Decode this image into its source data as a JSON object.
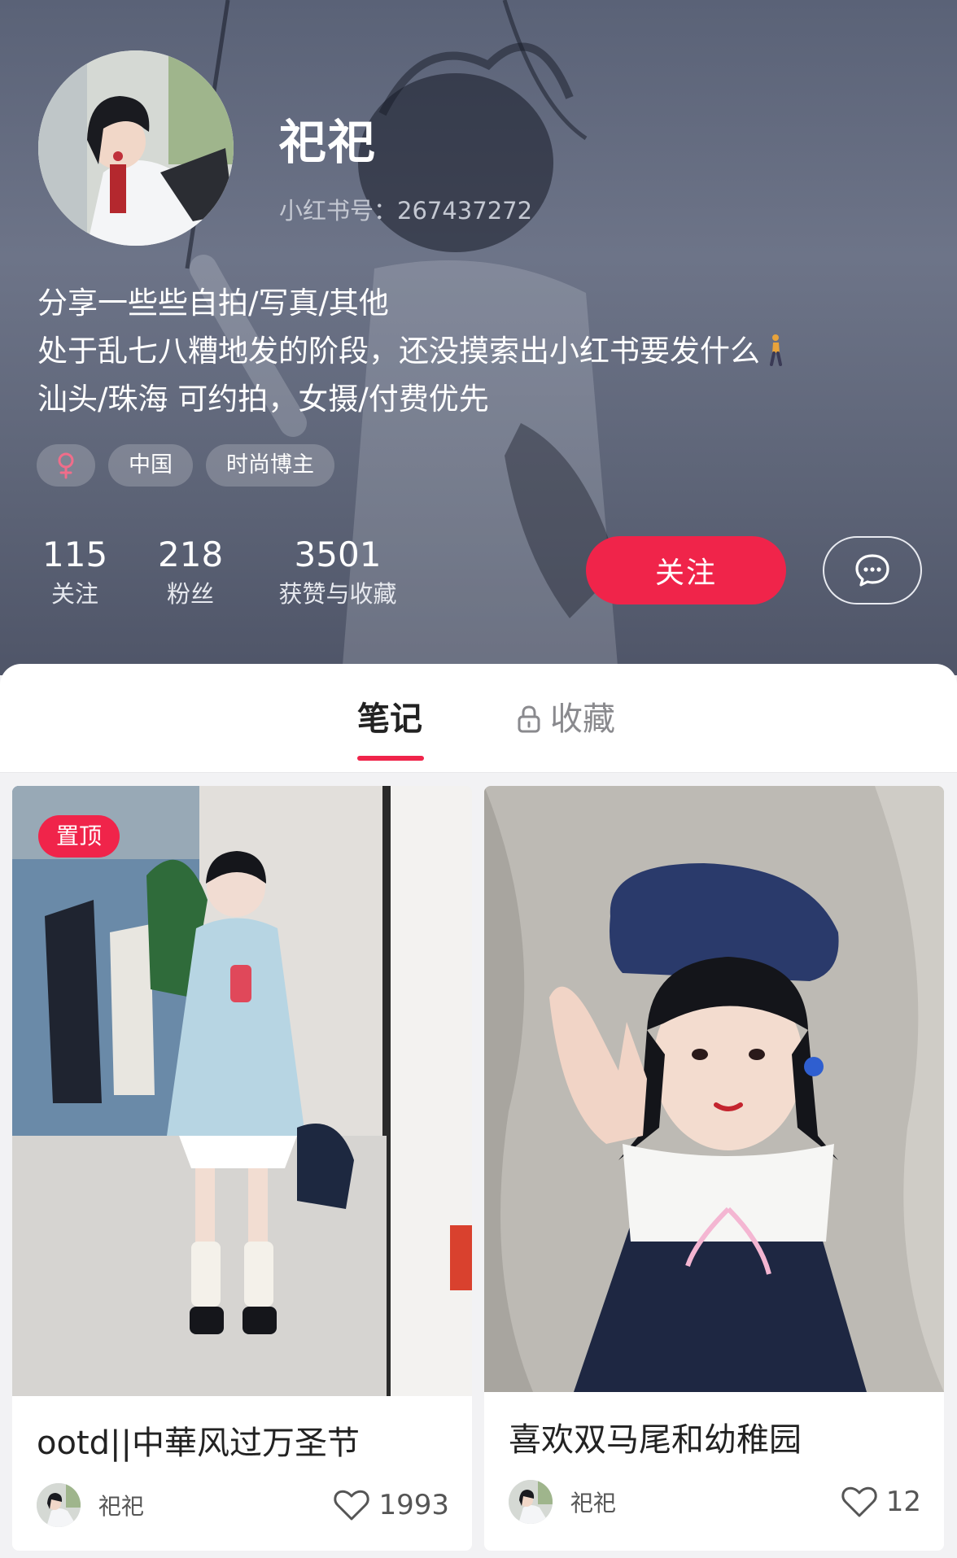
{
  "profile": {
    "nickname": "祀祀",
    "user_id_text": "小红书号：267437272",
    "bio": [
      "分享一些些自拍/写真/其他",
      "处于乱七八糟地发的阶段，还没摸索出小红书要发什么",
      "汕头/珠海 可约拍，女摄/付费优先"
    ],
    "tags": {
      "gender_icon": "female-icon",
      "region": "中国",
      "category": "时尚博主"
    },
    "stats": [
      {
        "num": "115",
        "label": "关注"
      },
      {
        "num": "218",
        "label": "粉丝"
      },
      {
        "num": "3501",
        "label": "获赞与收藏"
      }
    ],
    "follow_label": "关注",
    "chat_icon": "chat-bubble-icon"
  },
  "tabs": {
    "notes": "笔记",
    "favorites": "收藏",
    "favorites_icon": "lock-icon"
  },
  "notes": [
    {
      "badge": "置顶",
      "title": "ootd||中華风过万圣节",
      "author": "祀祀",
      "likes": "1993"
    },
    {
      "title": "喜欢双马尾和幼稚园",
      "author": "祀祀",
      "likes": "12"
    }
  ],
  "colors": {
    "accent": "#f0244a",
    "header_bg": "#5f6679"
  }
}
